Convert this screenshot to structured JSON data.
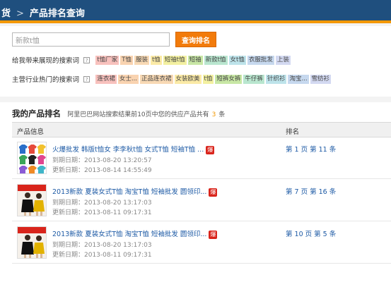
{
  "header": {
    "crumb_first": "货",
    "crumb_sep": ">",
    "crumb_title": "产品排名查询"
  },
  "search": {
    "value": "新款t恤",
    "button_label": "查询排名"
  },
  "keyword_rows": [
    {
      "label": "给我带来展现的搜索词",
      "help": "?",
      "tags": [
        {
          "text": "t恤厂家",
          "color": "#f8c1bd"
        },
        {
          "text": "T恤",
          "color": "#f9d3b0"
        },
        {
          "text": "服装",
          "color": "#f8d9b4"
        },
        {
          "text": "t恤",
          "color": "#fbeaa6"
        },
        {
          "text": "短袖t恤",
          "color": "#f3f0a0"
        },
        {
          "text": "短袖",
          "color": "#c8e7a5"
        },
        {
          "text": "新款t恤",
          "color": "#b9e6cf"
        },
        {
          "text": "女t恤",
          "color": "#bde3ea"
        },
        {
          "text": "衣服批发",
          "color": "#c6d8ee"
        },
        {
          "text": "上装",
          "color": "#d3d9f1"
        }
      ]
    },
    {
      "label": "主营行业热门的搜索词",
      "help": "?",
      "tags": [
        {
          "text": "连衣裙",
          "color": "#f8c1bd"
        },
        {
          "text": "女士...",
          "color": "#f9d3b0"
        },
        {
          "text": "正品连衣裙",
          "color": "#f8d9b4"
        },
        {
          "text": "女装欧美",
          "color": "#fbeaa6"
        },
        {
          "text": "t恤",
          "color": "#f3f0a0"
        },
        {
          "text": "短裤女裤",
          "color": "#c8e7a5"
        },
        {
          "text": "牛仔裤",
          "color": "#b9e6cf"
        },
        {
          "text": "针织衫",
          "color": "#bde3ea"
        },
        {
          "text": "淘宝...",
          "color": "#c6d8ee"
        },
        {
          "text": "雪纺衫",
          "color": "#d3d9f1"
        }
      ]
    }
  ],
  "results": {
    "title": "我的产品排名",
    "desc_before": "阿里巴巴网站搜索结果前10页中您的供应产品共有",
    "count": "3",
    "desc_after": "条",
    "col_info": "产品信息",
    "col_rank": "排名",
    "hot_label": "爆",
    "rows": [
      {
        "title": "火爆批发 韩版t恤女 李李秋t恤 女式T恤 短袖T恤 ...",
        "expire": "到期日期：2013-08-20 13:20:57",
        "update": "更新日期：2013-08-14 14:55:49",
        "rank": "第 1 页 第 11 条"
      },
      {
        "title": "2013新款 夏装女式T恤 淘宝T恤 短袖批发 圆领印...",
        "expire": "到期日期：2013-08-20 13:17:03",
        "update": "更新日期：2013-08-11 09:17:31",
        "rank": "第 7 页 第 16 条"
      },
      {
        "title": "2013新款 夏装女式T恤 淘宝T恤 短袖批发 圆领印...",
        "expire": "到期日期：2013-08-20 13:17:03",
        "update": "更新日期：2013-08-11 09:17:31",
        "rank": "第 10 页 第 5 条"
      }
    ]
  },
  "colors": {
    "header_bg": "#1f4f7e",
    "accent_orange": "#f39800",
    "button_orange": "#f27b0b",
    "link_blue": "#1d5aa5",
    "hot_red": "#d9241b"
  }
}
